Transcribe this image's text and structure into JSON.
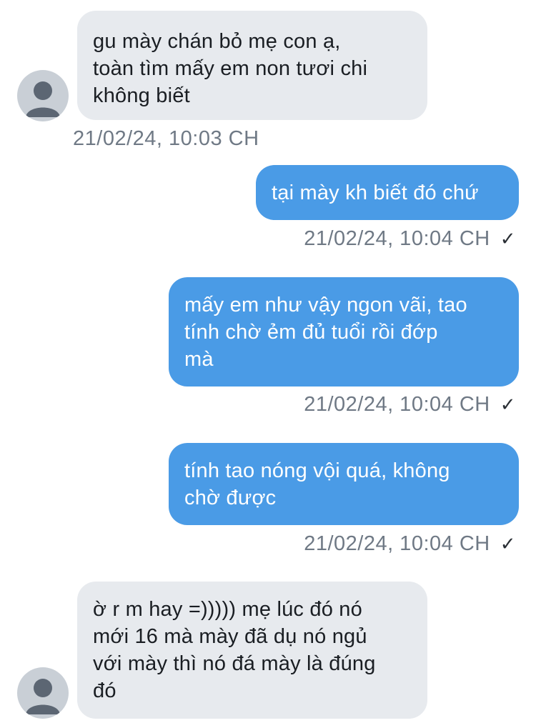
{
  "messages": [
    {
      "direction": "in",
      "text": "gu mày chán bỏ mẹ con ạ,\ntoàn tìm mấy em non tươi chi\nkhông biết",
      "time": "21/02/24, 10:03 CH"
    },
    {
      "direction": "out",
      "text": "tại mày kh biết đó chứ",
      "time": "21/02/24, 10:04 CH",
      "status_icon": "✓"
    },
    {
      "direction": "out",
      "text": "mấy em như vậy ngon vãi, tao\ntính chờ ẻm đủ tuổi rồi đớp\nmà",
      "time": "21/02/24, 10:04 CH",
      "status_icon": "✓"
    },
    {
      "direction": "out",
      "text": "tính tao nóng vội quá, không\nchờ được",
      "time": "21/02/24, 10:04 CH",
      "status_icon": "✓"
    },
    {
      "direction": "in",
      "text": "ờ r m hay =))))) mẹ lúc đó nó\nmới 16 mà mày đã dụ nó ngủ\nvới mày thì nó đá mày là đúng\nđó"
    }
  ],
  "colors": {
    "incoming_bubble": "#e7eaee",
    "outgoing_bubble": "#4a9be6",
    "timestamp": "#6f7985",
    "avatar": "#c9cfd6"
  },
  "icons": {
    "avatar": "default-user-avatar-icon",
    "status": "sent-check-icon"
  }
}
